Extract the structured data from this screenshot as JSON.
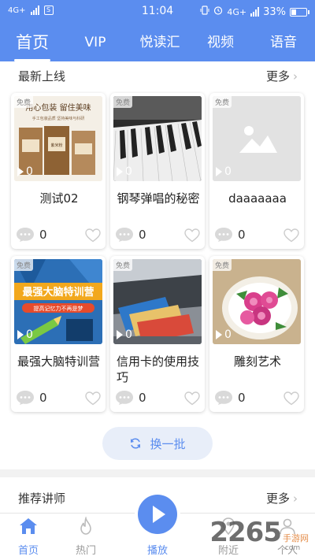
{
  "status_bar": {
    "network": "4G+",
    "sim_icon": "S",
    "time": "11:04",
    "right_network": "4G+",
    "battery": "33%"
  },
  "top_nav": {
    "tabs": [
      {
        "label": "首页",
        "active": true
      },
      {
        "label": "VIP"
      },
      {
        "label": "悦读汇"
      },
      {
        "label": "视频"
      },
      {
        "label": "语音"
      }
    ]
  },
  "latest": {
    "title": "最新上线",
    "more": "更多",
    "free_badge": "免费",
    "items": [
      {
        "title": "测试02",
        "plays": "0",
        "comments": "0",
        "thumb": "packaged-food-photo"
      },
      {
        "title": "钢琴弹唱的秘密",
        "plays": "0",
        "comments": "0",
        "thumb": "piano-keys-photo"
      },
      {
        "title": "daaaaaaa",
        "plays": "0",
        "comments": "0",
        "thumb": "placeholder-image"
      },
      {
        "title": "最强大脑特训营",
        "plays": "0",
        "comments": "0",
        "thumb": "brain-training-poster"
      },
      {
        "title": "信用卡的使用技巧",
        "plays": "0",
        "comments": "0",
        "thumb": "credit-cards-photo"
      },
      {
        "title": "雕刻艺术",
        "plays": "0",
        "comments": "0",
        "thumb": "carved-flowers-photo"
      }
    ],
    "poster_texts": {
      "food_header": "用心包装 留住美味",
      "food_sub": "手工包装品质 坚持美味与科研",
      "food_bag": "紫米粉",
      "brain_main": "最强大脑特训营",
      "brain_sub": "提高记忆力不再是梦"
    },
    "refresh_label": "换一批"
  },
  "teachers": {
    "title": "推荐讲师",
    "more": "更多"
  },
  "bottom_nav": {
    "home": "首页",
    "hot": "热门",
    "play": "播放",
    "nearby": "附近",
    "me": "个人"
  },
  "watermark": {
    "number": "2265",
    "suffix": ".com",
    "text": "手游网"
  },
  "colors": {
    "primary": "#5b8def",
    "text": "#333333"
  }
}
